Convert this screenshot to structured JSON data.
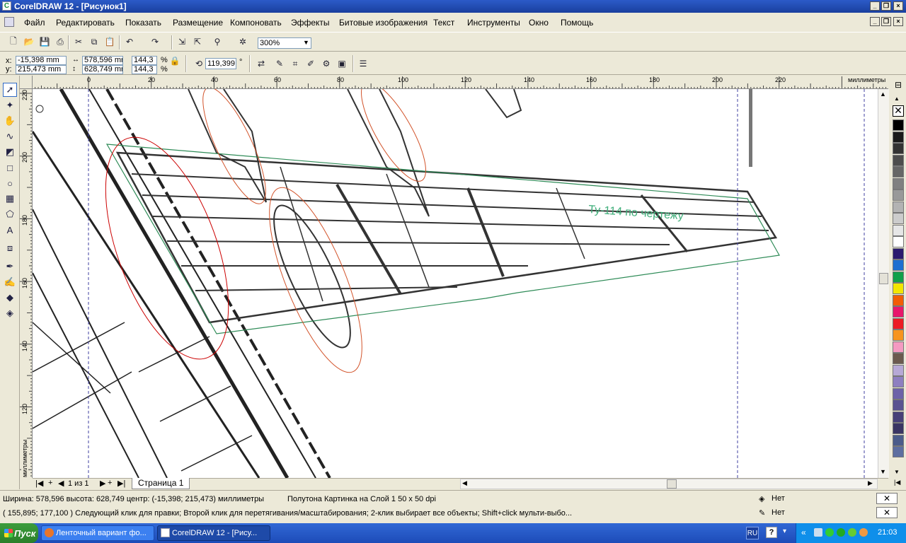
{
  "window": {
    "title": "CorelDRAW 12 - [Рисунок1]",
    "app_icon_glyph": "C"
  },
  "menubar": {
    "items": [
      "Файл",
      "Редактировать",
      "Показать",
      "Размещение",
      "Компоновать",
      "Эффекты",
      "Битовые изображения",
      "Текст",
      "Инструменты",
      "Окно",
      "Помощь"
    ]
  },
  "toolbar": {
    "zoom_value": "300%"
  },
  "property_bar": {
    "x_label": "x:",
    "y_label": "y:",
    "x_value": "-15,398 mm",
    "y_value": "215,473 mm",
    "width_value": "578,596 mr",
    "height_value": "628,749 mr",
    "scale_x": "144,3",
    "scale_y": "144,3",
    "percent": "%",
    "rotation_value": "119,399",
    "degree": "°"
  },
  "rulers": {
    "unit_h": "миллиметры",
    "unit_v": "миллиметры",
    "h_ticks": [
      "0",
      "20",
      "40",
      "60",
      "80",
      "100",
      "120",
      "140",
      "160",
      "180",
      "200",
      "220"
    ],
    "v_ticks": [
      "220",
      "200",
      "180",
      "160",
      "140",
      "120"
    ]
  },
  "drawing": {
    "annotation_text": "Ту-114 по чертежу"
  },
  "pagebar": {
    "page_counter": "1 из 1",
    "page_tab": "Страница 1"
  },
  "statusbar": {
    "line1": "Ширина: 578,596  высота: 628,749  центр: (-15,398; 215,473)  миллиметры",
    "object_info": "Полутона Картинка на Слой 1 50 x 50 dpi",
    "line2": "( 155,895; 177,100 )   Следующий клик для правки; Второй клик для перетягивания/масштабирования; 2-клик выбирает все объекты; Shift+click мульти-выбо...",
    "fill_label": "Нет",
    "outline_label": "Нет"
  },
  "palette": {
    "colors": [
      "#000000",
      "#1a1a1a",
      "#333333",
      "#4d4d4d",
      "#666666",
      "#808080",
      "#999999",
      "#b3b3b3",
      "#cccccc",
      "#e6e6e6",
      "#ffffff",
      "#2b1a6e",
      "#1e6fd0",
      "#11a04a",
      "#f2e600",
      "#f25c05",
      "#e8176b",
      "#ec1c24",
      "#f7941d",
      "#f49ac1",
      "#6b5a4e",
      "#b7a9d6",
      "#8e7fc0",
      "#6d62a8",
      "#5a5290",
      "#474078",
      "#3a3563",
      "#4b5c8a",
      "#5d6ea0"
    ]
  },
  "taskbar": {
    "start_label": "Пуск",
    "task1": "Ленточный вариант фо...",
    "task2": "CorelDRAW 12 - [Рису...",
    "lang": "RU",
    "clock": "21:03"
  }
}
